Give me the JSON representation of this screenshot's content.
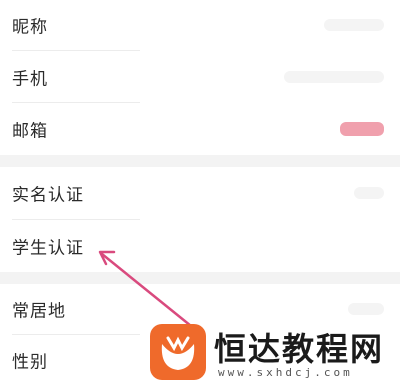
{
  "settings": {
    "group1": [
      {
        "id": "nickname",
        "label": "昵称"
      },
      {
        "id": "phone",
        "label": "手机"
      },
      {
        "id": "email",
        "label": "邮箱"
      }
    ],
    "group2": [
      {
        "id": "real-name-verification",
        "label": "实名认证"
      },
      {
        "id": "student-verification",
        "label": "学生认证"
      }
    ],
    "group3": [
      {
        "id": "residence",
        "label": "常居地"
      },
      {
        "id": "gender",
        "label": "性别"
      }
    ]
  },
  "annotation": {
    "arrow_color": "#d94a7e",
    "target": "学生认证"
  },
  "watermark": {
    "brand": "恒达教程网",
    "url": "www.sxhdcj.com",
    "logo_color": "#ef6a2b"
  },
  "colors": {
    "email_badge": "#f0a0ad",
    "section_gap": "#f3f3f3"
  }
}
